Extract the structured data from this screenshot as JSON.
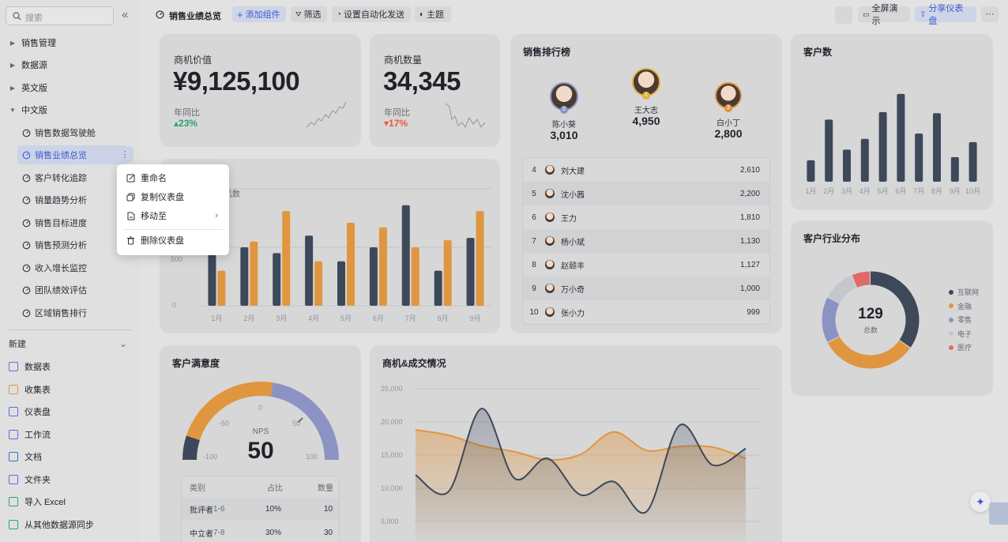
{
  "sidebar": {
    "search_placeholder": "搜索",
    "groups": [
      {
        "label": "销售管理"
      },
      {
        "label": "数据源"
      },
      {
        "label": "英文版"
      },
      {
        "label": "中文版"
      }
    ],
    "dashboards": [
      {
        "label": "销售数据驾驶舱"
      },
      {
        "label": "销售业绩总览"
      },
      {
        "label": "客户转化追踪"
      },
      {
        "label": "销量趋势分析"
      },
      {
        "label": "销售目标进度"
      },
      {
        "label": "销售预测分析"
      },
      {
        "label": "收入增长监控"
      },
      {
        "label": "团队绩效评估"
      },
      {
        "label": "区域销售排行"
      }
    ],
    "new_label": "新建",
    "new_items": [
      {
        "label": "数据表",
        "icon": "table-icon"
      },
      {
        "label": "收集表",
        "icon": "form-icon"
      },
      {
        "label": "仪表盘",
        "icon": "dashboard-icon"
      },
      {
        "label": "工作流",
        "icon": "workflow-icon"
      },
      {
        "label": "文档",
        "icon": "doc-icon"
      },
      {
        "label": "文件夹",
        "icon": "folder-icon"
      },
      {
        "label": "导入 Excel",
        "icon": "excel-icon"
      },
      {
        "label": "从其他数据源同步",
        "icon": "sync-icon"
      }
    ]
  },
  "toolbar": {
    "title": "销售业绩总览",
    "add_widget": "添加组件",
    "filter": "筛选",
    "automation": "设置自动化发送",
    "theme": "主题",
    "fullscreen": "全屏演示",
    "share": "分享仪表盘",
    "more": "···"
  },
  "context_menu": {
    "rename": "重命名",
    "copy": "复制仪表盘",
    "move": "移动至",
    "delete": "删除仪表盘"
  },
  "kpi": {
    "opportunity_value_label": "商机价值",
    "opportunity_value": "¥9,125,100",
    "opportunity_yoy_label": "年同比",
    "opportunity_yoy": "23%",
    "opportunity_count_label": "商机数量",
    "opportunity_count": "34,345",
    "count_yoy_label": "年同比",
    "count_yoy": "17%"
  },
  "ranking": {
    "title": "销售排行榜",
    "podium": [
      {
        "rank": "2",
        "name": "陈小葵",
        "value": "3,010"
      },
      {
        "rank": "1",
        "name": "王大志",
        "value": "4,950"
      },
      {
        "rank": "3",
        "name": "白小丁",
        "value": "2,800"
      }
    ],
    "rows": [
      {
        "rank": "4",
        "name": "刘大建",
        "value": "2,610"
      },
      {
        "rank": "5",
        "name": "沈小茜",
        "value": "2,200"
      },
      {
        "rank": "6",
        "name": "王力",
        "value": "1,810"
      },
      {
        "rank": "7",
        "name": "杨小斌",
        "value": "1,130"
      },
      {
        "rank": "8",
        "name": "赵颐丰",
        "value": "1,127"
      },
      {
        "rank": "9",
        "name": "万小奇",
        "value": "1,000"
      },
      {
        "rank": "10",
        "name": "张小力",
        "value": "999"
      }
    ]
  },
  "bar_chart_labels": {
    "legend_fragment": "机数",
    "y_ticks": [
      "500",
      "0"
    ],
    "months": [
      "1月",
      "2月",
      "3月",
      "4月",
      "5月",
      "6月",
      "7月",
      "8月",
      "9月"
    ]
  },
  "customer_count": {
    "title": "客户数",
    "months": [
      "1月",
      "2月",
      "3月",
      "4月",
      "5月",
      "6月",
      "7月",
      "8月",
      "9月",
      "10月"
    ]
  },
  "industry": {
    "title": "客户行业分布",
    "total": "129",
    "total_label": "总数",
    "legend": [
      {
        "name": "互联网",
        "color": "#3d4859"
      },
      {
        "name": "金融",
        "color": "#e0963f"
      },
      {
        "name": "零售",
        "color": "#8b93c5"
      },
      {
        "name": "电子",
        "color": "#c4c7cc"
      },
      {
        "name": "医疗",
        "color": "#e06a6a"
      }
    ]
  },
  "satisfaction": {
    "title": "客户满意度",
    "nps_label": "NPS",
    "nps_value": "50",
    "ticks": [
      "-100",
      "-50",
      "0",
      "50",
      "100"
    ],
    "table_headers": [
      "类别",
      "占比",
      "数量"
    ],
    "rows": [
      {
        "category": "批评者",
        "range": "1-6",
        "pct": "10%",
        "count": "10"
      },
      {
        "category": "中立者",
        "range": "7-8",
        "pct": "30%",
        "count": "30"
      }
    ]
  },
  "area_chart": {
    "title": "商机&成交情况",
    "y_ticks": [
      "25,000",
      "20,000",
      "15,000",
      "10,000",
      "5,000"
    ]
  },
  "chart_data": [
    {
      "type": "bar",
      "title": "",
      "categories": [
        "1月",
        "2月",
        "3月",
        "4月",
        "5月",
        "6月",
        "7月",
        "8月",
        "9月"
      ],
      "series": [
        {
          "name": "",
          "color": "#3d4859",
          "values": [
            560,
            500,
            450,
            600,
            380,
            500,
            860,
            300,
            580
          ]
        },
        {
          "name": "",
          "color": "#e0963f",
          "values": [
            300,
            550,
            810,
            380,
            710,
            670,
            500,
            560,
            810
          ]
        }
      ],
      "ylim": [
        0,
        1000
      ]
    },
    {
      "type": "bar",
      "title": "客户数",
      "categories": [
        "1月",
        "2月",
        "3月",
        "4月",
        "5月",
        "6月",
        "7月",
        "8月",
        "9月",
        "10月"
      ],
      "series": [
        {
          "name": "",
          "color": "#3d4859",
          "values": [
            20,
            58,
            30,
            40,
            65,
            82,
            45,
            64,
            23,
            37
          ]
        }
      ],
      "ylim": [
        0,
        90
      ]
    },
    {
      "type": "pie",
      "title": "客户行业分布",
      "categories": [
        "互联网",
        "金融",
        "零售",
        "电子",
        "医疗"
      ],
      "values": [
        45,
        42,
        20,
        14,
        8
      ]
    },
    {
      "type": "area",
      "title": "商机&成交情况",
      "x": [
        0,
        1,
        2,
        3,
        4,
        5,
        6,
        7,
        8,
        9,
        10
      ],
      "series": [
        {
          "name": "",
          "color": "#e0963f",
          "values": [
            18800,
            18000,
            16400,
            15500,
            14300,
            15100,
            18500,
            15700,
            16300,
            16200,
            14500
          ]
        },
        {
          "name": "",
          "color": "#3d4859",
          "values": [
            12000,
            9500,
            22000,
            11500,
            14500,
            9000,
            11000,
            6500,
            19500,
            13500,
            16000
          ]
        }
      ],
      "ylim": [
        5000,
        25000
      ]
    },
    {
      "type": "gauge",
      "title": "客户满意度",
      "value": 50,
      "range": [
        -100,
        100
      ]
    }
  ]
}
